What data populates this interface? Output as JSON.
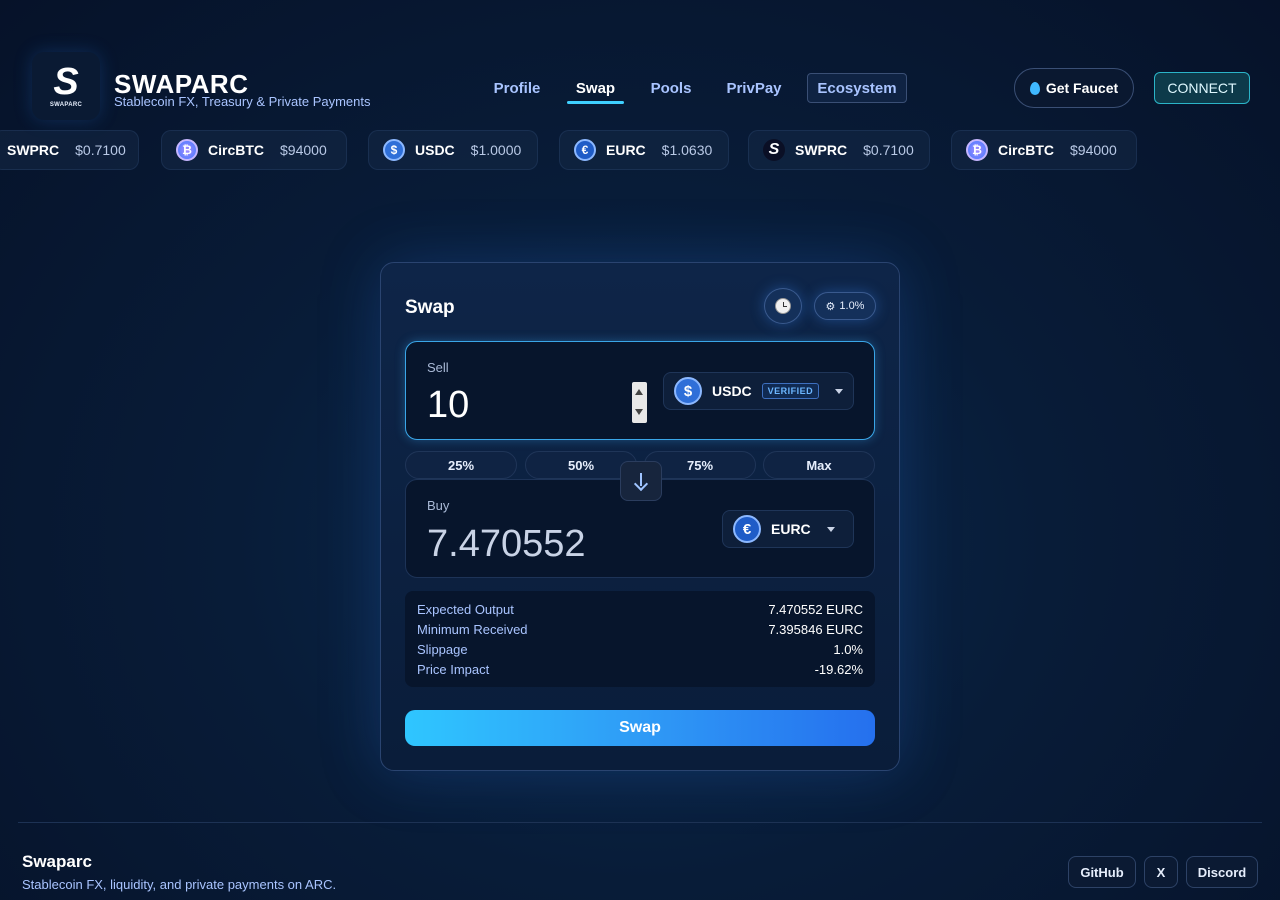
{
  "brand": {
    "logo_letter": "S",
    "logo_word": "SWAPARC",
    "title": "SWAPARC",
    "subtitle": "Stablecoin FX, Treasury & Private Payments"
  },
  "nav": {
    "items": [
      {
        "label": "Profile"
      },
      {
        "label": "Swap",
        "active": true
      },
      {
        "label": "Pools"
      },
      {
        "label": "PrivPay"
      },
      {
        "label": "Ecosystem"
      }
    ]
  },
  "header_actions": {
    "faucet_label": "Get Faucet",
    "connect_label": "CONNECT"
  },
  "ticker": [
    {
      "symbol": "SWPRC",
      "price": "$0.7100",
      "icon": "swprc-icon"
    },
    {
      "symbol": "CircBTC",
      "price": "$94000",
      "icon": "circbtc-icon"
    },
    {
      "symbol": "USDC",
      "price": "$1.0000",
      "icon": "usdc-icon"
    },
    {
      "symbol": "EURC",
      "price": "$1.0630",
      "icon": "eurc-icon"
    },
    {
      "symbol": "SWPRC",
      "price": "$0.7100",
      "icon": "swprc-icon"
    },
    {
      "symbol": "CircBTC",
      "price": "$94000",
      "icon": "circbtc-icon"
    }
  ],
  "swap": {
    "title": "Swap",
    "slippage_badge": "1.0%",
    "sell": {
      "label": "Sell",
      "amount": "10",
      "token": "USDC",
      "token_glyph": "$",
      "badge": "VERIFIED"
    },
    "percent_buttons": [
      "25%",
      "50%",
      "75%",
      "Max"
    ],
    "buy": {
      "label": "Buy",
      "amount": "7.470552",
      "token": "EURC",
      "token_glyph": "€"
    },
    "details": [
      {
        "label": "Expected Output",
        "value": "7.470552 EURC"
      },
      {
        "label": "Minimum Received",
        "value": "7.395846 EURC"
      },
      {
        "label": "Slippage",
        "value": "1.0%"
      },
      {
        "label": "Price Impact",
        "value": "-19.62%"
      }
    ],
    "submit_label": "Swap"
  },
  "footer": {
    "title": "Swaparc",
    "subtitle": "Stablecoin FX, liquidity, and private payments on ARC.",
    "links": [
      "GitHub",
      "X",
      "Discord"
    ]
  },
  "colors": {
    "accent": "#3fd0ff",
    "button_start": "#2fc6ff",
    "button_end": "#2570ee",
    "background": "#081c38"
  }
}
